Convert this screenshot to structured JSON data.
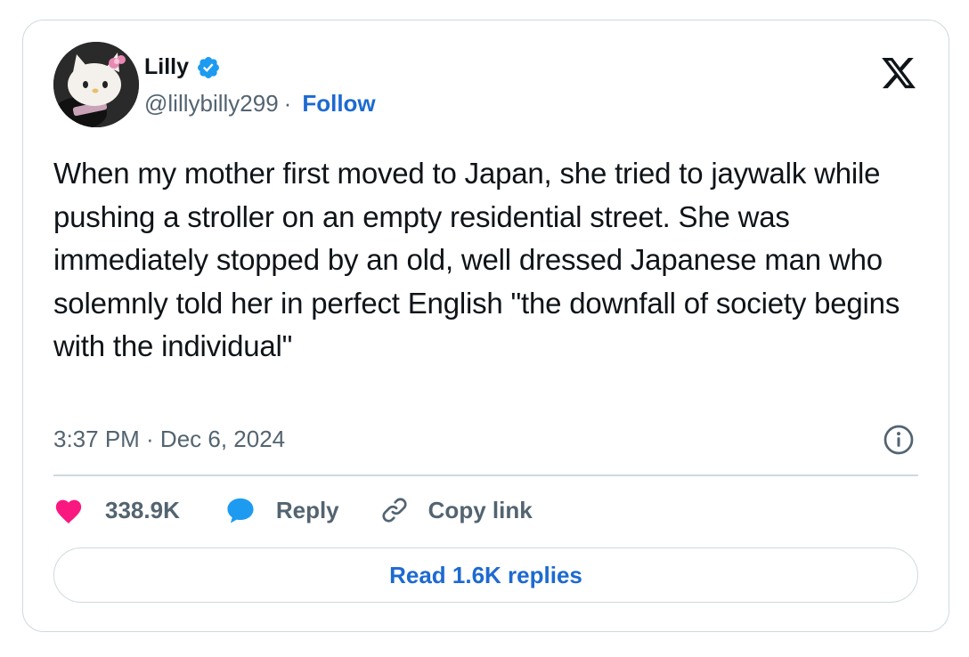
{
  "user": {
    "name": "Lilly",
    "handle": "@lillybilly299",
    "separator": "·",
    "follow_label": "Follow"
  },
  "tweet": {
    "text": "When my mother first moved to Japan, she tried to jaywalk while pushing a stroller on an empty residential street. She was immediately stopped by an old, well dressed Japanese man who solemnly told her in perfect English \"the downfall of society begins with the individual\"",
    "timestamp": "3:37 PM · Dec 6, 2024"
  },
  "actions": {
    "like_count": "338.9K",
    "reply_label": "Reply",
    "copy_label": "Copy link"
  },
  "read_replies_label": "Read 1.6K replies",
  "icons": {
    "verified": "verified-badge-icon",
    "logo": "x-logo-icon",
    "info": "info-icon",
    "like": "heart-icon",
    "reply": "speech-bubble-icon",
    "copy": "link-icon"
  },
  "colors": {
    "accent": "#1d6ad1",
    "verified": "#1d9bf0",
    "like": "#f91880",
    "muted": "#536471",
    "border": "#cfd9de"
  }
}
